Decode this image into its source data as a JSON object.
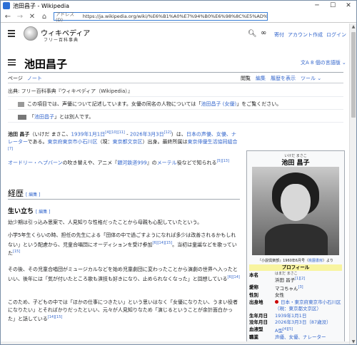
{
  "window": {
    "title": "池田昌子 - Wikipedia",
    "address_label": "アドレス(D)",
    "url": "https://ja.wikipedia.org/wiki/%E6%B1%A0%E7%94%B0%E6%98%8C%E5%AD%90"
  },
  "header": {
    "logo_text": "ウィキペディア",
    "logo_sub": "フリー百科事典",
    "links": [
      "寄付",
      "アカウント作成",
      "ログイン"
    ]
  },
  "title": {
    "text": "池田昌子",
    "lang_button": "8 個の言語版"
  },
  "tabs": {
    "left": [
      {
        "label": "ページ",
        "active": true
      },
      {
        "label": "ノート",
        "active": false
      }
    ],
    "right": [
      {
        "label": "閲覧",
        "active": true
      },
      {
        "label": "編集",
        "active": false
      },
      {
        "label": "履歴を表示",
        "active": false
      },
      {
        "label": "ツール",
        "active": false
      }
    ]
  },
  "source_line": "出典: フリー百科事典『ウィキペディア（Wikipedia）』",
  "hatnote1": {
    "pre": "この項目では、声優について記述しています。女優の同名の人物については「",
    "link": "池田昌子 (女優)",
    "post": "」をご覧ください。"
  },
  "hatnote2": {
    "pre": "「",
    "link": "池田昌子",
    "post": "」とは別人です。"
  },
  "intro": {
    "name": "池田 昌子",
    "reading": "（いけだ まさこ、",
    "birth": "1939年1月1日",
    "refs1": "[4][10][11]",
    "dash": " - ",
    "death": "2026年3月3日",
    "refs2": "[12]",
    "p1_mid": "）は、",
    "japan": "日本",
    "female": "の声優、女優",
    "narrator": "、ナレーター",
    "dearu": "である。",
    "birthplace": "東京府東京市小石川区",
    "now": "（現：",
    "bunkyo": "東京都文京区",
    "p1_end": "）出身。最終所属は",
    "coop": "東京俳優生活協同組合",
    "ref7": "[7]",
    "p2_a": "オードリー・ヘプバーン",
    "p2_b": "の吹き替えや、アニメ『",
    "p2_c": "銀河鉄道999",
    "p2_d": "』の",
    "p2_e": "メーテル",
    "p2_f": "役などで知られる",
    "ref513": "[5][13]"
  },
  "section_career": {
    "title": "経歴",
    "edit": "[ 編集 ]"
  },
  "section_early": {
    "title": "生い立ち",
    "edit": "[ 編集 ]"
  },
  "early": {
    "p1": "幼少期は引っ込み思案で、人見知りな性格だったことから母親も心配していたという。",
    "p2": "小学5年生くらいの時、担任の先生による「団体の中で過ごすようになれば多少は改善されるかもしれない」という配慮から、児童合唱団にオーディションを受け参加",
    "p2_refs": "[6][14][15]",
    "p2_end": "。当初は童謡などを歌っていた",
    "p2_ref": "[15]",
    "p3": "その後、その児童合唱団がミュージカルなどを始め児童劇団に変わったことから演劇の世界へ入ったといい、後年には「気が付いたところ歌も演技も好きになり、止められなくなった」と回想している",
    "p3_ref": "[6][14]",
    "p4": "このため、子どもの中では「ほかの仕事につきたい」という思いはなく「女優になりたい、うまい役者になりたい」とそればかりだったといい、元々が人見知りなため「演じるということが余計面白かった」と話している",
    "p4_ref": "[14][15]"
  },
  "infobox": {
    "ruby": "いけだ まさこ",
    "name": "池田 昌子",
    "caption_pre": "『小説倶楽部』1960年6月号（",
    "caption_link": "桃園書房",
    "caption_post": "）より",
    "profile": "プロフィール",
    "rows": [
      {
        "k": "本名",
        "ruby": "はまだ まさこ",
        "v": "浜田 昌子",
        "ref": "[1][2]",
        "link": false
      },
      {
        "k": "愛称",
        "v": "マコちゃん",
        "ref": "[3]",
        "link": false
      },
      {
        "k": "性別",
        "v": "女性",
        "link": false
      },
      {
        "k": "出身地",
        "v": "日本・東京府東京市小石川区（現：東京都文京区）",
        "link": true,
        "flag": true
      },
      {
        "k": "生年月日",
        "v": "1939年1月1日",
        "link": true
      },
      {
        "k": "没年月日",
        "v": "2026年3月3日（87歳没）",
        "link": true
      },
      {
        "k": "血液型",
        "v": "A型",
        "ref": "[4][5]",
        "link": true
      },
      {
        "k": "職業",
        "v": "声優、女優、ナレーター",
        "link": true
      }
    ]
  }
}
